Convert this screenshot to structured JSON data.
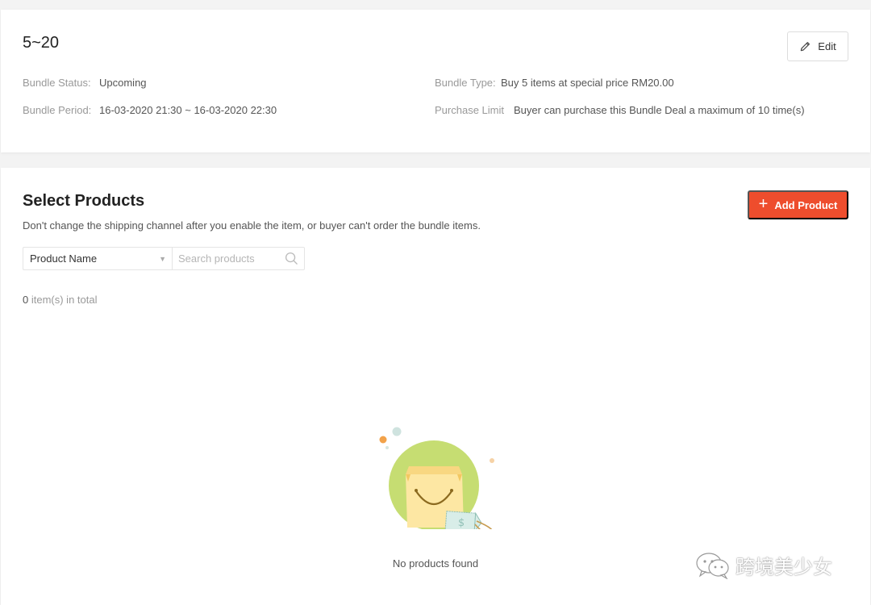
{
  "bundle": {
    "title": "5~20",
    "edit_label": "Edit",
    "status_label": "Bundle Status:",
    "status_value": "Upcoming",
    "period_label": "Bundle Period:",
    "period_value": "16-03-2020 21:30 ~ 16-03-2020 22:30",
    "type_label": "Bundle Type:",
    "type_value": "Buy 5 items at special price RM20.00",
    "limit_label": "Purchase Limit",
    "limit_value": "Buyer can purchase this Bundle Deal a maximum of 10 time(s)"
  },
  "products": {
    "title": "Select Products",
    "hint": "Don't change the shipping channel after you enable the item, or buyer can't order the bundle items.",
    "add_label": "Add Product",
    "filter_selected": "Product Name",
    "search_placeholder": "Search products",
    "total_count": "0",
    "total_suffix": " item(s) in total",
    "empty_text": "No products found"
  },
  "watermark": {
    "text": "跨境美少女"
  },
  "colors": {
    "accent": "#ee4d2d",
    "background": "#f3f3f3"
  },
  "icons": {
    "edit": "pencil-icon",
    "add": "plus-icon",
    "search": "search-icon",
    "select": "caret-down-icon",
    "empty": "shopping-bag-illustration",
    "watermark": "wechat-icon"
  }
}
